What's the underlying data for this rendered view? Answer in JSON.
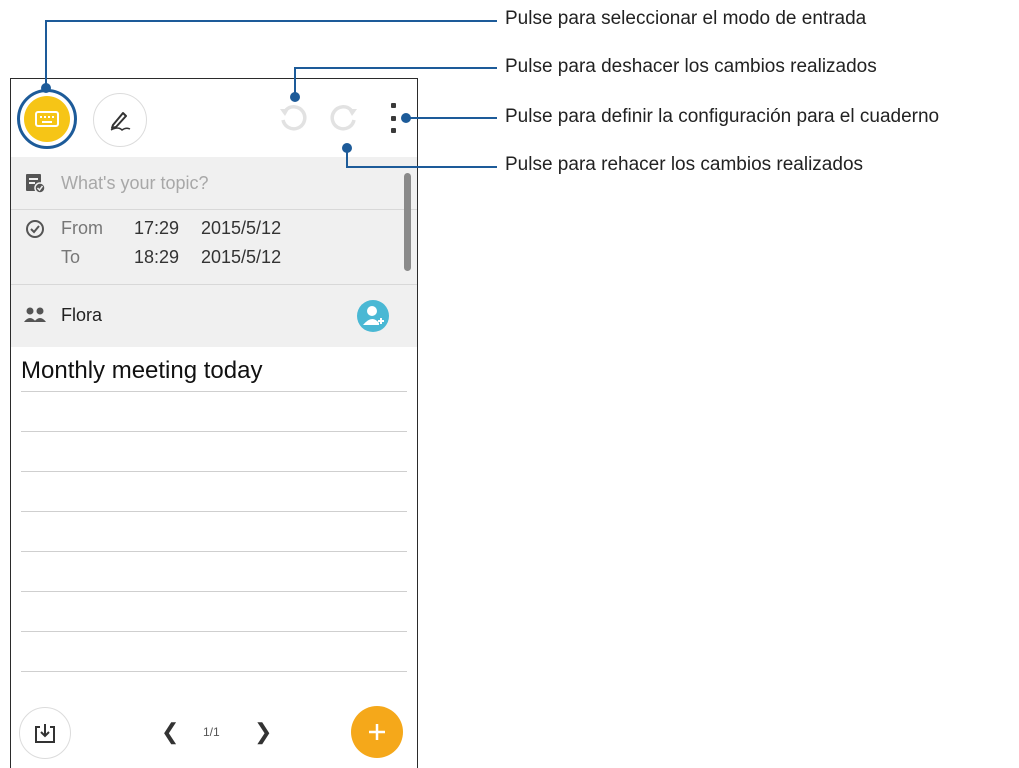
{
  "callouts": {
    "input_mode": "Pulse para seleccionar el modo de entrada",
    "undo": "Pulse para deshacer los cambios realizados",
    "settings": "Pulse para definir la configuración para el cuaderno",
    "redo": "Pulse para rehacer los cambios realizados"
  },
  "toolbar": {
    "keyboard_icon": "keyboard-icon",
    "pen_icon": "handwriting-pen-icon",
    "undo_icon": "undo-icon",
    "redo_icon": "redo-icon",
    "menu_icon": "more-vertical-icon"
  },
  "topic": {
    "placeholder": "What's your topic?"
  },
  "schedule": {
    "from_label": "From",
    "from_time": "17:29",
    "from_date": "2015/5/12",
    "to_label": "To",
    "to_time": "18:29",
    "to_date": "2015/5/12"
  },
  "attendees": {
    "name": "Flora"
  },
  "note": {
    "text": "Monthly meeting today"
  },
  "pager": {
    "prev": "❮",
    "page": "1/1",
    "next": "❯"
  },
  "colors": {
    "accent_yellow": "#f6c516",
    "fab_orange": "#f5a81a",
    "callout_blue": "#1d5b99",
    "add_person_blue": "#4ab8d4"
  }
}
